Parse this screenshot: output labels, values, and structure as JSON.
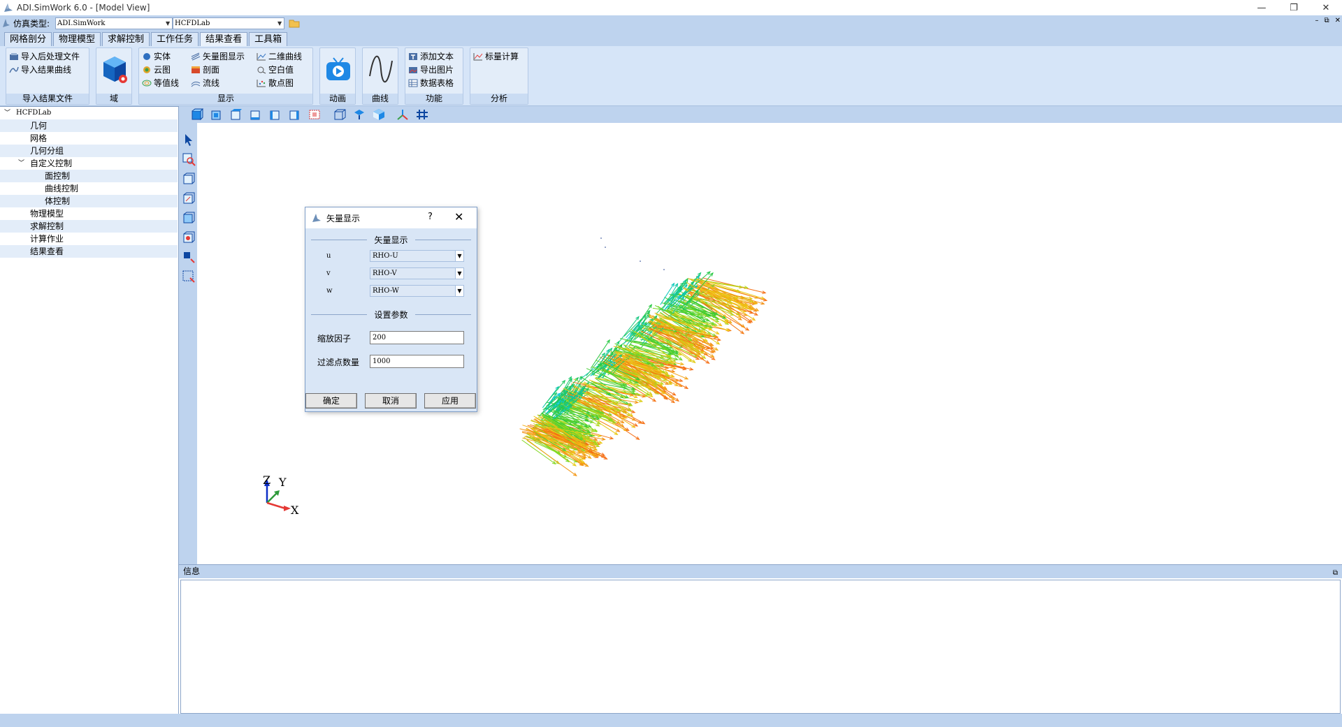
{
  "window": {
    "title": "ADI.SimWork 6.0 - [Model View]",
    "minimize": "—",
    "maximize": "❐",
    "close": "✕"
  },
  "simrow": {
    "label": "仿真类型:",
    "sim_type": "ADI.SimWork",
    "project": "HCFDLab",
    "mdi_minimize": "–",
    "mdi_restore": "⧉",
    "mdi_close": "✕"
  },
  "tabs": [
    "网格剖分",
    "物理模型",
    "求解控制",
    "工作任务",
    "结果查看",
    "工具箱"
  ],
  "ribbon": {
    "import": {
      "title": "导入结果文件",
      "items": [
        "导入后处理文件",
        "导入结果曲线"
      ]
    },
    "domain": {
      "title": "域"
    },
    "display": {
      "title": "显示",
      "col1": [
        "实体",
        "云图",
        "等值线"
      ],
      "col2": [
        "矢量图显示",
        "剖面",
        "流线"
      ],
      "col3": [
        "二维曲线",
        "空白值",
        "散点图"
      ]
    },
    "animation": {
      "title": "动画"
    },
    "curve": {
      "title": "曲线"
    },
    "function": {
      "title": "功能",
      "items": [
        "添加文本",
        "导出图片",
        "数据表格"
      ]
    },
    "analysis": {
      "title": "分析",
      "items": [
        "标量计算"
      ]
    }
  },
  "tree": {
    "root": "HCFDLab",
    "items": [
      "几何",
      "网格",
      "几何分组",
      "自定义控制",
      "面控制",
      "曲线控制",
      "体控制",
      "物理模型",
      "求解控制",
      "计算作业",
      "结果查看"
    ]
  },
  "axes": {
    "z": "Z",
    "y": "Y",
    "x": "X"
  },
  "info": {
    "title": "信息"
  },
  "dialog": {
    "title": "矢量显示",
    "help": "?",
    "close": "✕",
    "section_vector": "矢量显示",
    "u_label": "u",
    "v_label": "v",
    "w_label": "w",
    "u_value": "RHO-U",
    "v_value": "RHO-V",
    "w_value": "RHO-W",
    "section_params": "设置参数",
    "scale_label": "缩放因子",
    "scale_value": "200",
    "filter_label": "过滤点数量",
    "filter_value": "1000",
    "ok": "确定",
    "cancel": "取消",
    "apply": "应用"
  },
  "colors": {
    "ribbon_bg": "#d6e5f8",
    "panel_blue": "#bed3ee",
    "accent": "#2b7bd6"
  }
}
